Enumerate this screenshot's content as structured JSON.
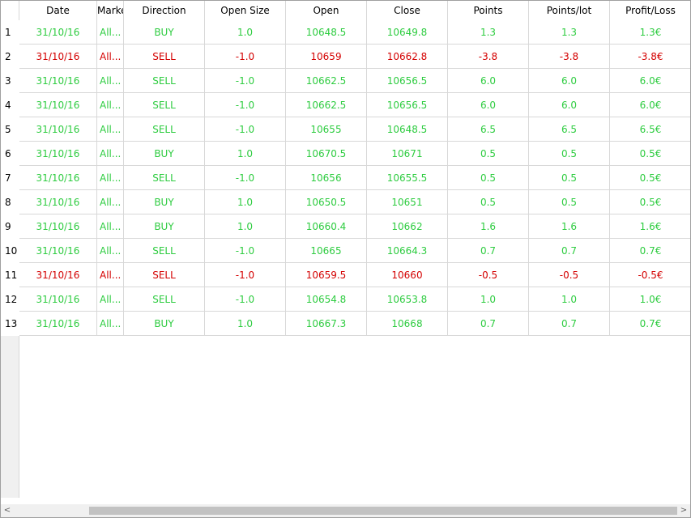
{
  "columns": {
    "date": "Date",
    "market": "Market",
    "direction": "Direction",
    "open_size": "Open Size",
    "open": "Open",
    "close": "Close",
    "points": "Points",
    "points_lot": "Points/lot",
    "profit_loss": "Profit/Loss"
  },
  "rows": [
    {
      "n": "1",
      "date": "31/10/16",
      "market": "All...",
      "direction": "BUY",
      "open_size": "1.0",
      "open": "10648.5",
      "close": "10649.8",
      "points": "1.3",
      "points_lot": "1.3",
      "profit_loss": "1.3€",
      "status": "up"
    },
    {
      "n": "2",
      "date": "31/10/16",
      "market": "All...",
      "direction": "SELL",
      "open_size": "-1.0",
      "open": "10659",
      "close": "10662.8",
      "points": "-3.8",
      "points_lot": "-3.8",
      "profit_loss": "-3.8€",
      "status": "down"
    },
    {
      "n": "3",
      "date": "31/10/16",
      "market": "All...",
      "direction": "SELL",
      "open_size": "-1.0",
      "open": "10662.5",
      "close": "10656.5",
      "points": "6.0",
      "points_lot": "6.0",
      "profit_loss": "6.0€",
      "status": "up"
    },
    {
      "n": "4",
      "date": "31/10/16",
      "market": "All...",
      "direction": "SELL",
      "open_size": "-1.0",
      "open": "10662.5",
      "close": "10656.5",
      "points": "6.0",
      "points_lot": "6.0",
      "profit_loss": "6.0€",
      "status": "up"
    },
    {
      "n": "5",
      "date": "31/10/16",
      "market": "All...",
      "direction": "SELL",
      "open_size": "-1.0",
      "open": "10655",
      "close": "10648.5",
      "points": "6.5",
      "points_lot": "6.5",
      "profit_loss": "6.5€",
      "status": "up"
    },
    {
      "n": "6",
      "date": "31/10/16",
      "market": "All...",
      "direction": "BUY",
      "open_size": "1.0",
      "open": "10670.5",
      "close": "10671",
      "points": "0.5",
      "points_lot": "0.5",
      "profit_loss": "0.5€",
      "status": "up"
    },
    {
      "n": "7",
      "date": "31/10/16",
      "market": "All...",
      "direction": "SELL",
      "open_size": "-1.0",
      "open": "10656",
      "close": "10655.5",
      "points": "0.5",
      "points_lot": "0.5",
      "profit_loss": "0.5€",
      "status": "up"
    },
    {
      "n": "8",
      "date": "31/10/16",
      "market": "All...",
      "direction": "BUY",
      "open_size": "1.0",
      "open": "10650.5",
      "close": "10651",
      "points": "0.5",
      "points_lot": "0.5",
      "profit_loss": "0.5€",
      "status": "up"
    },
    {
      "n": "9",
      "date": "31/10/16",
      "market": "All...",
      "direction": "BUY",
      "open_size": "1.0",
      "open": "10660.4",
      "close": "10662",
      "points": "1.6",
      "points_lot": "1.6",
      "profit_loss": "1.6€",
      "status": "up"
    },
    {
      "n": "10",
      "date": "31/10/16",
      "market": "All...",
      "direction": "SELL",
      "open_size": "-1.0",
      "open": "10665",
      "close": "10664.3",
      "points": "0.7",
      "points_lot": "0.7",
      "profit_loss": "0.7€",
      "status": "up"
    },
    {
      "n": "11",
      "date": "31/10/16",
      "market": "All...",
      "direction": "SELL",
      "open_size": "-1.0",
      "open": "10659.5",
      "close": "10660",
      "points": "-0.5",
      "points_lot": "-0.5",
      "profit_loss": "-0.5€",
      "status": "down"
    },
    {
      "n": "12",
      "date": "31/10/16",
      "market": "All...",
      "direction": "SELL",
      "open_size": "-1.0",
      "open": "10654.8",
      "close": "10653.8",
      "points": "1.0",
      "points_lot": "1.0",
      "profit_loss": "1.0€",
      "status": "up"
    },
    {
      "n": "13",
      "date": "31/10/16",
      "market": "All...",
      "direction": "BUY",
      "open_size": "1.0",
      "open": "10667.3",
      "close": "10668",
      "points": "0.7",
      "points_lot": "0.7",
      "profit_loss": "0.7€",
      "status": "up"
    }
  ],
  "colors": {
    "positive": "#2ecc40",
    "negative": "#d40000"
  },
  "scrollbar": {
    "left_icon": "scroll-left-icon",
    "right_icon": "scroll-right-icon",
    "left_glyph": "<",
    "right_glyph": ">"
  }
}
